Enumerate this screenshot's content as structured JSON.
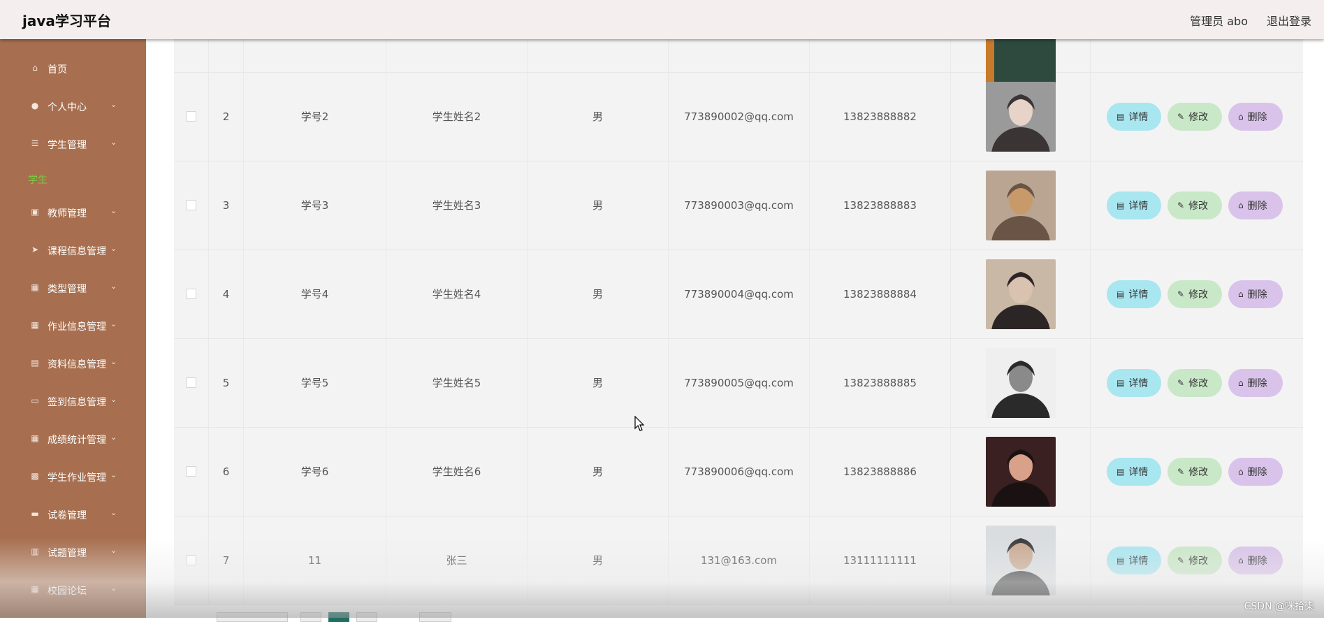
{
  "header": {
    "brand": "java学习平台",
    "user": "管理员 abo",
    "logout": "退出登录"
  },
  "sidebar": {
    "items": [
      {
        "label": "首页",
        "icon": "home-icon",
        "glyph": "⌂",
        "chevron": false
      },
      {
        "label": "个人中心",
        "icon": "person-icon",
        "glyph": "●",
        "chevron": true
      },
      {
        "label": "学生管理",
        "icon": "list-icon",
        "glyph": "☰",
        "chevron": true
      },
      {
        "label": "教师管理",
        "icon": "chart-icon",
        "glyph": "▣",
        "chevron": true
      },
      {
        "label": "课程信息管理",
        "icon": "send-icon",
        "glyph": "➤",
        "chevron": true
      },
      {
        "label": "类型管理",
        "icon": "grid-icon",
        "glyph": "▦",
        "chevron": true
      },
      {
        "label": "作业信息管理",
        "icon": "grid-icon",
        "glyph": "▦",
        "chevron": true
      },
      {
        "label": "资料信息管理",
        "icon": "clipboard-icon",
        "glyph": "▤",
        "chevron": true
      },
      {
        "label": "签到信息管理",
        "icon": "ticket-icon",
        "glyph": "▭",
        "chevron": true
      },
      {
        "label": "成绩统计管理",
        "icon": "grid-icon",
        "glyph": "▦",
        "chevron": true
      },
      {
        "label": "学生作业管理",
        "icon": "apps-icon",
        "glyph": "▩",
        "chevron": true
      },
      {
        "label": "试卷管理",
        "icon": "monitor-icon",
        "glyph": "▬",
        "chevron": true
      },
      {
        "label": "试题管理",
        "icon": "bar-chart-icon",
        "glyph": "▥",
        "chevron": true
      },
      {
        "label": "校园论坛",
        "icon": "grid-icon",
        "glyph": "▦",
        "chevron": true
      }
    ],
    "sub_item": "学生"
  },
  "table": {
    "rows": [
      {
        "idx": "2",
        "no": "学号2",
        "name": "学生姓名2",
        "sex": "男",
        "email": "773890002@qq.com",
        "phone": "13823888882",
        "photo_colors": [
          "#9a9a9a",
          "#3a3534",
          "#e8d3c8"
        ]
      },
      {
        "idx": "3",
        "no": "学号3",
        "name": "学生姓名3",
        "sex": "男",
        "email": "773890003@qq.com",
        "phone": "13823888883",
        "photo_colors": [
          "#b9a592",
          "#6a5446",
          "#c89a6a"
        ]
      },
      {
        "idx": "4",
        "no": "学号4",
        "name": "学生姓名4",
        "sex": "男",
        "email": "773890004@qq.com",
        "phone": "13823888884",
        "photo_colors": [
          "#c9b8a6",
          "#2c2526",
          "#d9c2b0"
        ]
      },
      {
        "idx": "5",
        "no": "学号5",
        "name": "学生姓名5",
        "sex": "男",
        "email": "773890005@qq.com",
        "phone": "13823888885",
        "photo_colors": [
          "#efefef",
          "#2a2a2a",
          "#8a8a8a"
        ]
      },
      {
        "idx": "6",
        "no": "学号6",
        "name": "学生姓名6",
        "sex": "男",
        "email": "773890006@qq.com",
        "phone": "13823888886",
        "photo_colors": [
          "#3a2020",
          "#1a1212",
          "#d9a08a"
        ]
      },
      {
        "idx": "7",
        "no": "11",
        "name": "张三",
        "sex": "男",
        "email": "131@163.com",
        "phone": "13111111111",
        "photo_colors": [
          "#d9dde0",
          "#3b3b3b",
          "#c9a890"
        ]
      }
    ],
    "actions": {
      "detail": "详情",
      "edit": "修改",
      "delete": "删除"
    }
  },
  "watermark": "CSDN @咪拾柒",
  "colors": {
    "sidebar_bg": "#a76f4f",
    "header_bg": "#f4eeee",
    "active_sub": "#7bc843",
    "btn_detail": "#a8e6f0",
    "btn_edit": "#c9e8c7",
    "btn_delete": "#d9c3ea"
  }
}
